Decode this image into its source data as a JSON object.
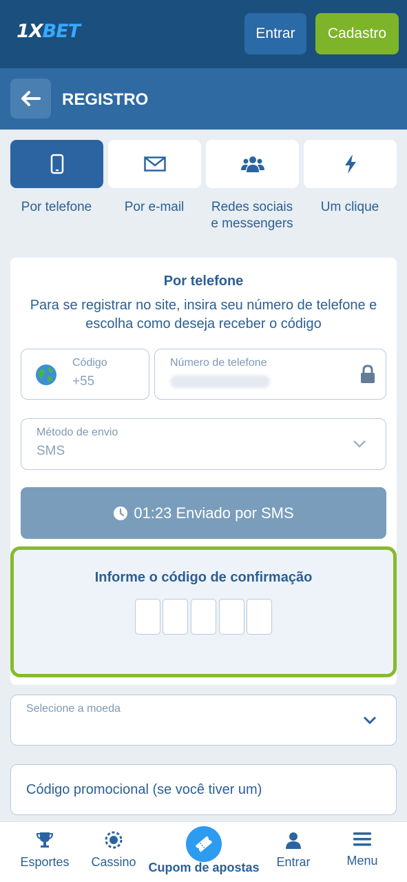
{
  "header": {
    "logo_prefix": "1X",
    "logo_suffix": "BET",
    "login_label": "Entrar",
    "signup_label": "Cadastro"
  },
  "registro_bar": {
    "title": "REGISTRO"
  },
  "tabs": [
    {
      "label": "Por telefone",
      "icon": "phone-icon",
      "active": true
    },
    {
      "label": "Por e-mail",
      "icon": "envelope-icon",
      "active": false
    },
    {
      "label_line1": "Redes sociais",
      "label_line2": "e messengers",
      "icon": "users-icon",
      "active": false
    },
    {
      "label": "Um clique",
      "icon": "lightning-icon",
      "active": false
    }
  ],
  "form": {
    "title": "Por telefone",
    "description": "Para se registrar no site, insira seu número de telefone e escolha como deseja receber o código",
    "code_label": "Código",
    "code_value": "+55",
    "phone_label": "Número de telefone",
    "method_label": "Método de envio",
    "method_value": "SMS",
    "send_status": "01:23 Enviado por SMS",
    "confirm_title": "Informe o código de confirmação",
    "currency_label": "Selecione a moeda",
    "promo_placeholder": "Código promocional (se você tiver um)"
  },
  "bottom_nav": [
    {
      "label": "Esportes",
      "icon": "trophy-icon"
    },
    {
      "label": "Cassino",
      "icon": "casino-chip-icon"
    },
    {
      "label": "Cupom de apostas",
      "icon": "ticket-icon"
    },
    {
      "label": "Entrar",
      "icon": "user-icon"
    },
    {
      "label": "Menu",
      "icon": "menu-icon"
    }
  ],
  "colors": {
    "header_bg": "#1b4f7d",
    "accent_green": "#86bb2b",
    "primary_blue": "#2b64a0",
    "text_blue": "#2b5f94"
  }
}
